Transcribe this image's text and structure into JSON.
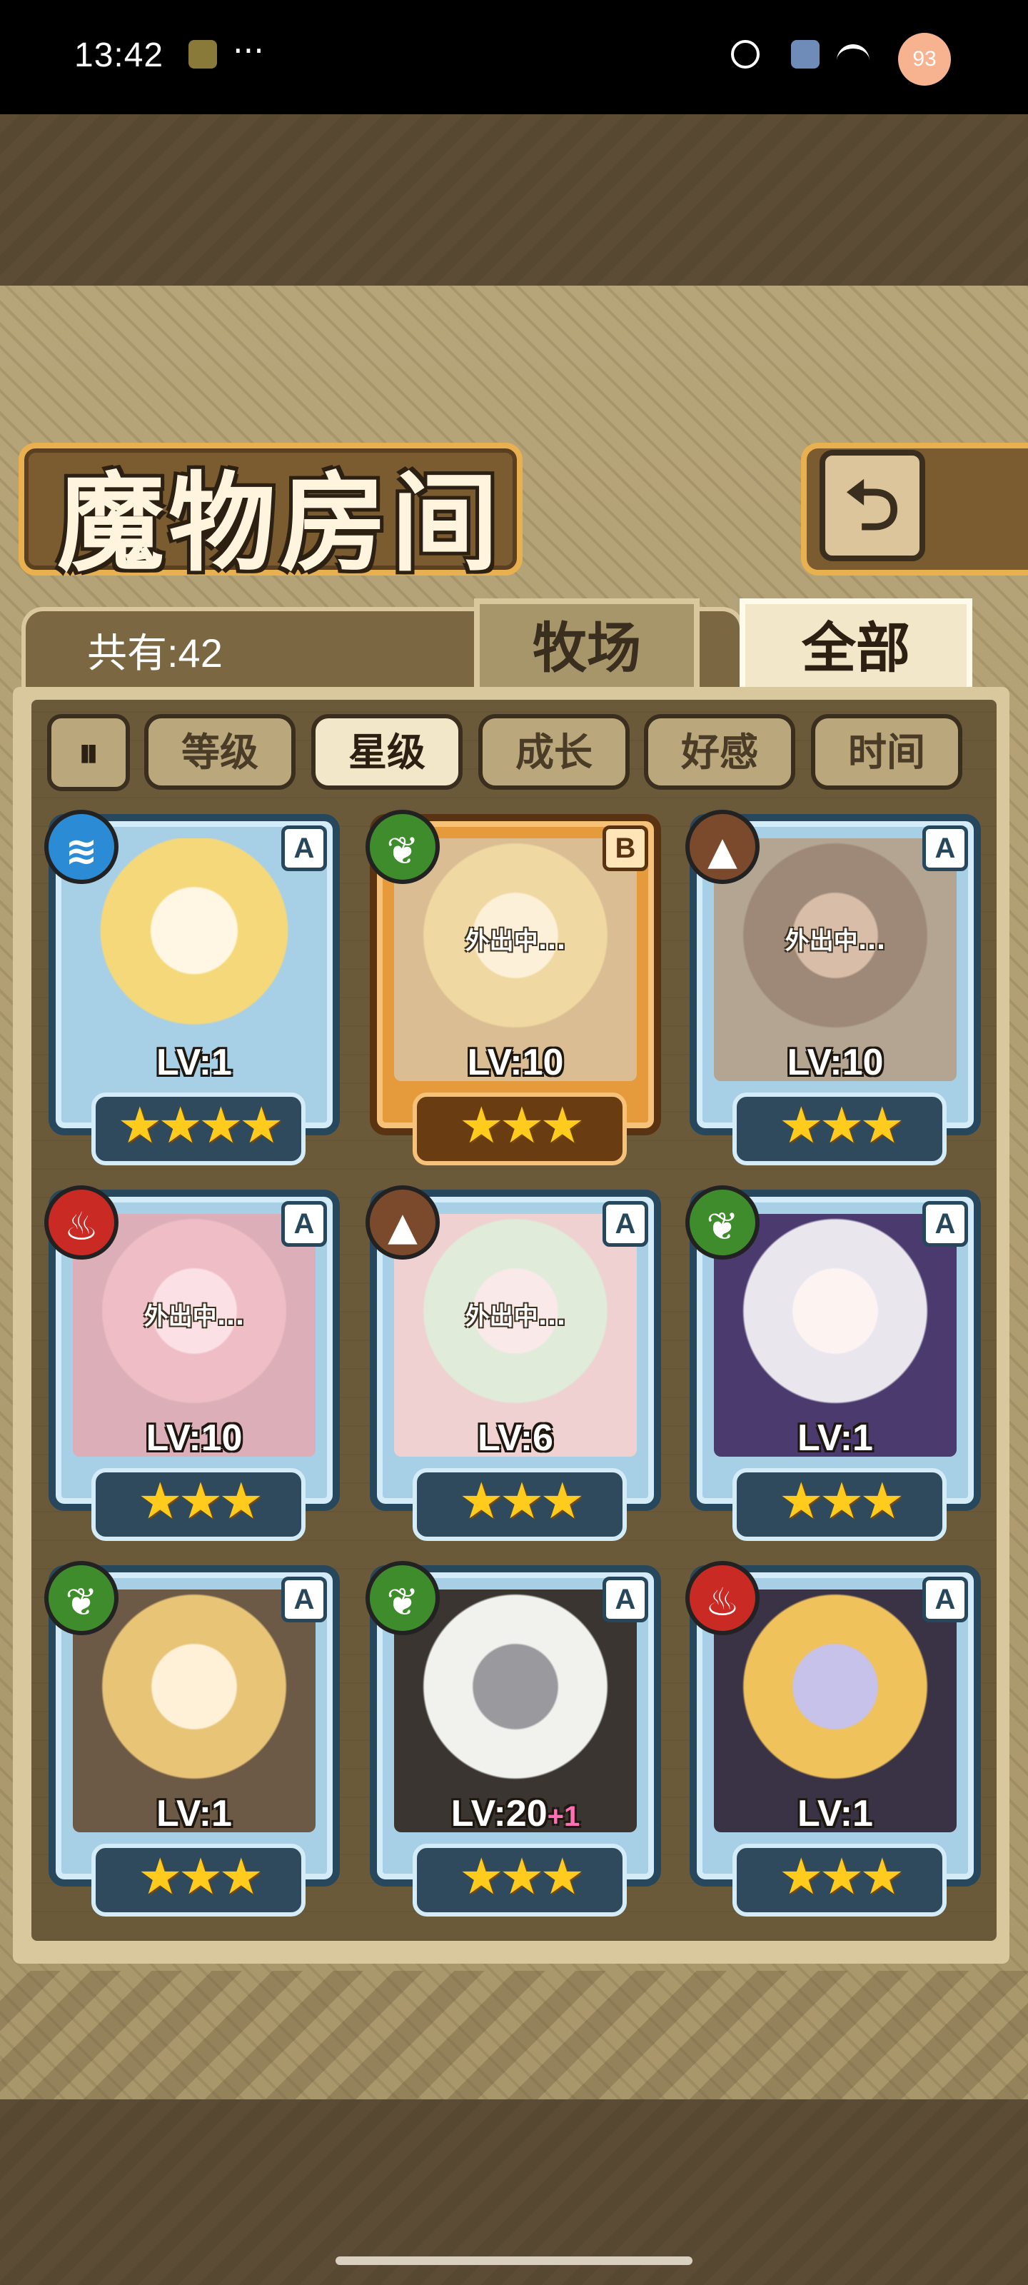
{
  "status_bar": {
    "time": "13:42",
    "more": "···",
    "battery": "93"
  },
  "header": {
    "title": "魔物房间",
    "back_icon": "⮌"
  },
  "count_label": "共有:42",
  "tabs": [
    {
      "label": "牧场",
      "active": false
    },
    {
      "label": "全部",
      "active": true
    }
  ],
  "sort_toggle": "⏸",
  "sort_buttons": [
    {
      "label": "等级",
      "active": false
    },
    {
      "label": "星级",
      "active": true
    },
    {
      "label": "成长",
      "active": false
    },
    {
      "label": "好感",
      "active": false
    },
    {
      "label": "时间",
      "active": false
    }
  ],
  "monsters": [
    {
      "element": "water",
      "rank": "A",
      "level": "LV:1",
      "plus": "",
      "stars": "★★★★",
      "away_label": ""
    },
    {
      "element": "nature",
      "rank": "B",
      "level": "LV:10",
      "plus": "",
      "stars": "★★★",
      "away_label": "外出中..."
    },
    {
      "element": "earth",
      "rank": "A",
      "level": "LV:10",
      "plus": "",
      "stars": "★★★",
      "away_label": "外出中..."
    },
    {
      "element": "fire",
      "rank": "A",
      "level": "LV:10",
      "plus": "",
      "stars": "★★★",
      "away_label": "外出中..."
    },
    {
      "element": "earth",
      "rank": "A",
      "level": "LV:6",
      "plus": "",
      "stars": "★★★",
      "away_label": "外出中..."
    },
    {
      "element": "nature",
      "rank": "A",
      "level": "LV:1",
      "plus": "",
      "stars": "★★★",
      "away_label": ""
    },
    {
      "element": "nature",
      "rank": "A",
      "level": "LV:1",
      "plus": "",
      "stars": "★★★",
      "away_label": ""
    },
    {
      "element": "nature",
      "rank": "A",
      "level": "LV:20",
      "plus": "+1",
      "stars": "★★★",
      "away_label": ""
    },
    {
      "element": "fire",
      "rank": "A",
      "level": "LV:1",
      "plus": "",
      "stars": "★★★",
      "away_label": ""
    }
  ],
  "colors": {
    "water": "#2b8bd4",
    "nature": "#3e8c2c",
    "earth": "#7b4a2c",
    "fire": "#c92a24"
  }
}
